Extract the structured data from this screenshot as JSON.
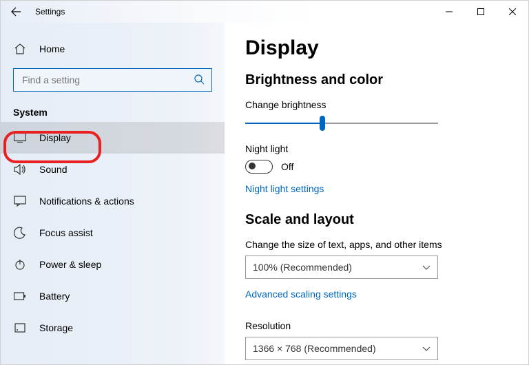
{
  "window": {
    "title": "Settings"
  },
  "sidebar": {
    "home": "Home",
    "search_placeholder": "Find a setting",
    "section": "System",
    "items": [
      {
        "label": "Display"
      },
      {
        "label": "Sound"
      },
      {
        "label": "Notifications & actions"
      },
      {
        "label": "Focus assist"
      },
      {
        "label": "Power & sleep"
      },
      {
        "label": "Battery"
      },
      {
        "label": "Storage"
      }
    ]
  },
  "main": {
    "heading": "Display",
    "section1": "Brightness and color",
    "brightness_label": "Change brightness",
    "brightness_percent": 40,
    "night_light_label": "Night light",
    "night_light_state": "Off",
    "night_light_link": "Night light settings",
    "section2": "Scale and layout",
    "scale_label": "Change the size of text, apps, and other items",
    "scale_value": "100% (Recommended)",
    "scale_link": "Advanced scaling settings",
    "resolution_label": "Resolution",
    "resolution_value": "1366 × 768 (Recommended)"
  }
}
